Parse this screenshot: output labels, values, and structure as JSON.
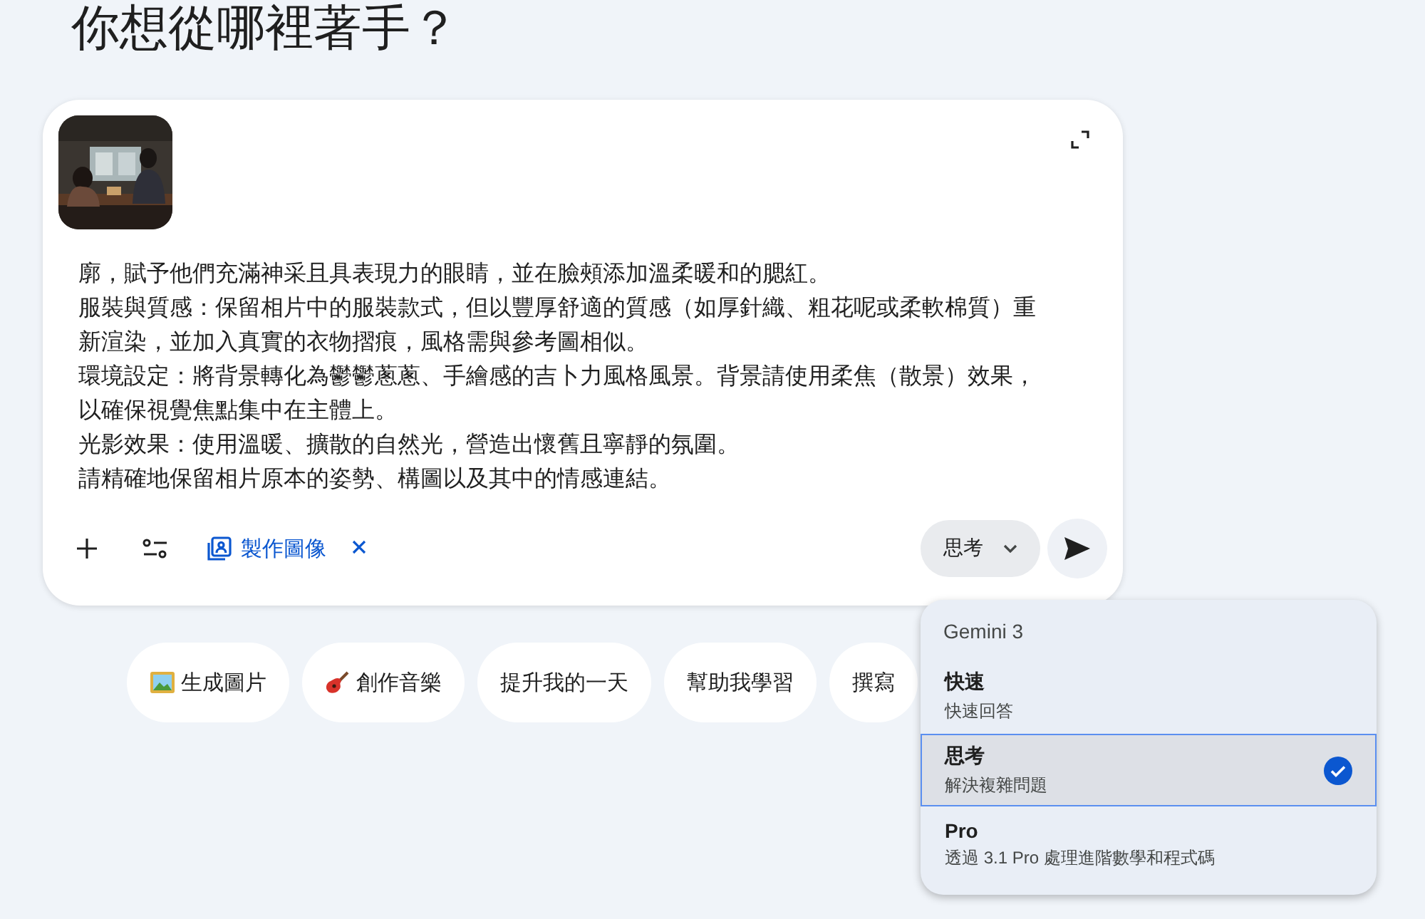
{
  "heading": "你想從哪裡著手？",
  "composer": {
    "prompt_lines": [
      "廓，賦予他們充滿神采且具表現力的眼睛，並在臉頰添加溫柔暖和的腮紅。",
      "服裝與質感：保留相片中的服裝款式，但以豐厚舒適的質感（如厚針織、粗花呢或柔軟棉質）重新渲染，並加入真實的衣物摺痕，風格需與參考圖相似。",
      "環境設定：將背景轉化為鬱鬱蔥蔥、手繪感的吉卜力風格風景。背景請使用柔焦（散景）效果，以確保視覺焦點集中在主體上。",
      "光影效果：使用溫暖、擴散的自然光，營造出懷舊且寧靜的氛圍。",
      "請精確地保留相片原本的姿勢、構圖以及其中的情感連結。"
    ],
    "tool_chip": {
      "label": "製作圖像"
    },
    "mode_button": {
      "label": "思考"
    }
  },
  "suggestions": [
    {
      "kind": "picture",
      "label": "生成圖片"
    },
    {
      "kind": "guitar",
      "label": "創作音樂"
    },
    {
      "kind": "none",
      "label": "提升我的一天"
    },
    {
      "kind": "none",
      "label": "幫助我學習"
    },
    {
      "kind": "none",
      "label": "撰寫"
    }
  ],
  "mode_menu": {
    "header": "Gemini 3",
    "items": [
      {
        "title": "快速",
        "subtitle": "快速回答",
        "selected": false
      },
      {
        "title": "思考",
        "subtitle": "解決複雜問題",
        "selected": true
      },
      {
        "title": "Pro",
        "subtitle": "透過 3.1 Pro 處理進階數學和程式碼",
        "selected": false
      }
    ]
  }
}
